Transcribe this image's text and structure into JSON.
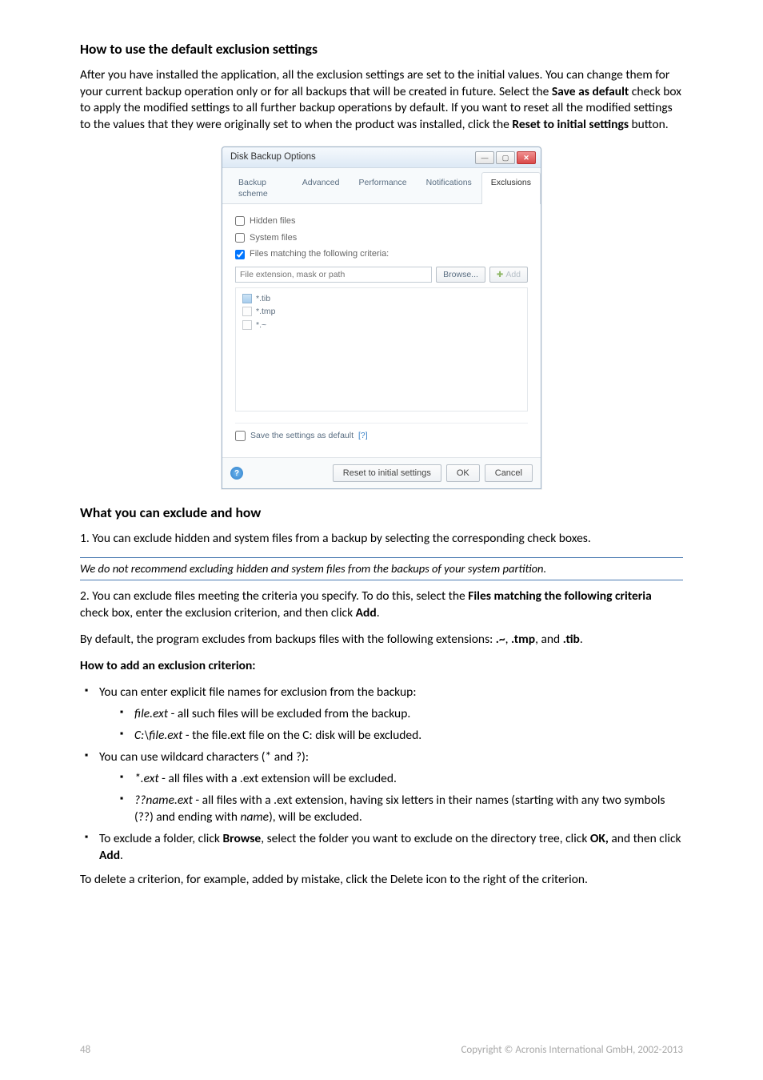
{
  "h1": "How to use the default exclusion settings",
  "p1a": "After you have installed the application, all the exclusion settings are set to the initial values. You can change them for your current backup operation only or for all backups that will be created in future. Select the ",
  "p1b": "Save as default",
  "p1c": " check box to apply the modified settings to all further backup operations by default. If you want to reset all the modified settings to the values that they were originally set to when the product was installed, click the ",
  "p1d": "Reset to initial settings",
  "p1e": " button.",
  "dialog": {
    "title": "Disk Backup Options",
    "tabs": {
      "t1": "Backup scheme",
      "t2": "Advanced",
      "t3": "Performance",
      "t4": "Notifications",
      "t5": "Exclusions"
    },
    "chk_hidden": "Hidden files",
    "chk_system": "System files",
    "chk_matching": "Files matching the following criteria:",
    "filter_placeholder": "File extension, mask or path",
    "browse": "Browse...",
    "add": "Add",
    "patterns": {
      "p1": "*.tib",
      "p2": "*.tmp",
      "p3": "*.~"
    },
    "save_default": "Save the settings as default ",
    "qmark": "[?]",
    "btn_reset": "Reset to initial settings",
    "btn_ok": "OK",
    "btn_cancel": "Cancel"
  },
  "h2": "What you can exclude and how",
  "p2": "1. You can exclude hidden and system files from a backup by selecting the corresponding check boxes.",
  "note": "We do not recommend excluding hidden and system files from the backups of your system partition.",
  "p3a": "2. You can exclude files meeting the criteria you specify. To do this, select the ",
  "p3b": "Files matching the following criteria",
  "p3c": " check box, enter the exclusion criterion, and then click ",
  "p3d": "Add",
  "p3e": ".",
  "p4a": "By default, the program excludes from backups files with the following extensions: ",
  "p4b": ".~",
  "p4c": ", ",
  "p4d": ".tmp",
  "p4e": ", and ",
  "p4f": ".tib",
  "p4g": ".",
  "h3": "How to add an exclusion criterion:",
  "b1": "You can enter explicit file names for exclusion from the backup:",
  "b1a_i": "file.ext",
  "b1a_t": " - all such files will be excluded from the backup.",
  "b1b_i": "C:\\file.ext",
  "b1b_t": " - the file.ext file on the C: disk will be excluded.",
  "b2": "You can use wildcard characters (* and ?):",
  "b2a_i": "*.ext",
  "b2a_t": " - all files with a .ext extension will be excluded.",
  "b2b_i": "??name.ext",
  "b2b_t1": " - all files with a .ext extension, having six letters in their names (starting with any two symbols (??) and ending with ",
  "b2b_i2": "name",
  "b2b_t2": "), will be excluded.",
  "b3a": "To exclude a folder, click ",
  "b3b": "Browse",
  "b3c": ", select the folder you want to exclude on the directory tree, click ",
  "b3d": "OK,",
  "b3e": " and then click ",
  "b3f": "Add",
  "b3g": ".",
  "p5": "To delete a criterion, for example, added by mistake, click the Delete icon to the right of the criterion.",
  "footer_left": "48",
  "footer_right": "Copyright © Acronis International GmbH, 2002-2013"
}
